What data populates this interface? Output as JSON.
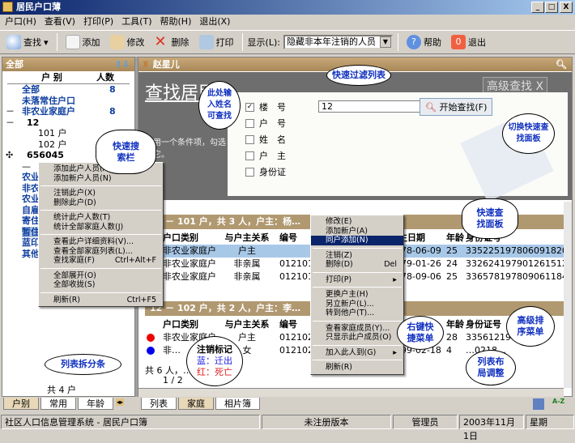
{
  "window": {
    "title": "居民户口薄",
    "min": "_",
    "max": "□",
    "close": "X"
  },
  "menu": [
    "户口(H)",
    "查看(V)",
    "打印(P)",
    "工具(T)",
    "帮助(H)",
    "退出(X)"
  ],
  "toolbar": {
    "find": "查找",
    "add": "添加",
    "edit": "修改",
    "delete": "删除",
    "print": "打印",
    "display_label": "显示(L):",
    "display_value": "隐藏非本年注销的人员",
    "help": "帮助",
    "exit": "退出"
  },
  "left": {
    "header": "全部",
    "col_type": "户 别",
    "col_count": "人数",
    "tree": [
      {
        "label": "全部",
        "count": "8",
        "cls": "blue",
        "pre": ""
      },
      {
        "label": "未落常住户口",
        "count": "",
        "cls": "blue",
        "pre": ""
      },
      {
        "label": "非农业家庭户",
        "count": "8",
        "cls": "blue",
        "pre": "－"
      },
      {
        "label": "12",
        "count": "",
        "cls": "bold",
        "pre": "－"
      },
      {
        "label": "101 户",
        "count": "",
        "cls": "",
        "pre": ""
      },
      {
        "label": "102 户",
        "count": "",
        "cls": "",
        "pre": ""
      },
      {
        "label": "656045",
        "count": "",
        "cls": "bold",
        "pre": "✣"
      },
      {
        "label": "—",
        "count": "",
        "cls": "",
        "pre": ""
      },
      {
        "label": "农业",
        "count": "",
        "cls": "blue",
        "pre": ""
      },
      {
        "label": "非农",
        "count": "",
        "cls": "blue",
        "pre": ""
      },
      {
        "label": "农业",
        "count": "",
        "cls": "blue",
        "pre": ""
      },
      {
        "label": "自雇",
        "count": "",
        "cls": "blue",
        "pre": ""
      },
      {
        "label": "寄住",
        "count": "",
        "cls": "blue",
        "pre": ""
      },
      {
        "label": "暂住",
        "count": "",
        "cls": "blue",
        "pre": ""
      },
      {
        "label": "蓝印",
        "count": "",
        "cls": "blue",
        "pre": ""
      },
      {
        "label": "其他",
        "count": "",
        "cls": "blue",
        "pre": ""
      }
    ],
    "footer": "共 4 户",
    "tabs": [
      "户别",
      "常用",
      "年龄"
    ]
  },
  "right": {
    "header": "赵星儿",
    "search_title": "查找居民",
    "search_hint": "使用一个条件项，勾选中它。",
    "advanced": "高级查找",
    "close": "X",
    "fields": [
      {
        "label": "楼　号",
        "checked": true,
        "value": "12"
      },
      {
        "label": "户　号",
        "checked": false
      },
      {
        "label": "姓　名",
        "checked": false
      },
      {
        "label": "户　主",
        "checked": false
      },
      {
        "label": "身份证",
        "checked": false
      }
    ],
    "start_search": "开始查找(F)",
    "columns": [
      "户口类别",
      "与户主关系",
      "编号",
      "出生日期",
      "年龄",
      "身份证号"
    ],
    "groups": [
      {
        "title": "12 － 101 户，共 3 人，户主：杨…",
        "rows": [
          [
            "非农业家庭户",
            "户主",
            "",
            "1978-06-09",
            "25",
            "335225197806091820"
          ],
          [
            "非农业家庭户",
            "非亲属",
            "0121010…",
            "1979-01-26",
            "24",
            "33262419790126151X"
          ],
          [
            "非农业家庭户",
            "非亲属",
            "0121010…",
            "1978-09-06",
            "25",
            "336578197809061184"
          ]
        ]
      },
      {
        "title": "12 － 102 户，共 2 人，户主：李…",
        "rows": [
          [
            "非农业家庭户",
            "户主",
            "0121020…",
            "",
            "28",
            "335612197…"
          ],
          [
            "非…",
            "女",
            "0121020…",
            "1999-02-18",
            "4",
            "…0218…"
          ]
        ]
      }
    ],
    "summary": "共 6 人，… 女 4 人",
    "page": "1 / 2",
    "tabs": [
      "列表",
      "家庭",
      "相片簿"
    ],
    "sort_label": "A-Z"
  },
  "context_left": [
    {
      "t": "添加此户人员(A)"
    },
    {
      "t": "添加新户人员(N)"
    },
    {
      "sep": 1
    },
    {
      "t": "注销此户(X)"
    },
    {
      "t": "删除此户(D)"
    },
    {
      "sep": 1
    },
    {
      "t": "统计此户人数(T)"
    },
    {
      "t": "统计全部家庭人数(J)"
    },
    {
      "sep": 1
    },
    {
      "t": "查看此户详细资料(V)..."
    },
    {
      "t": "查看全部家庭列表(L)..."
    },
    {
      "t": "查找家庭(F)",
      "k": "Ctrl+Alt+F"
    },
    {
      "sep": 1
    },
    {
      "t": "全部展开(O)"
    },
    {
      "t": "全部收拢(S)"
    },
    {
      "sep": 1
    },
    {
      "t": "刷新(R)",
      "k": "Ctrl+F5"
    }
  ],
  "context_right": [
    {
      "t": "修改(E)"
    },
    {
      "t": "添加新户(A)"
    },
    {
      "t": "同户添加(N)",
      "hl": 1
    },
    {
      "sep": 1
    },
    {
      "t": "注销(Z)"
    },
    {
      "t": "删除(D)",
      "k": "Del"
    },
    {
      "sep": 1
    },
    {
      "t": "打印(P)",
      "k": "▸"
    },
    {
      "sep": 1
    },
    {
      "t": "更换户主(H)"
    },
    {
      "t": "另立新户(L)..."
    },
    {
      "t": "转到他户(T)..."
    },
    {
      "sep": 1
    },
    {
      "t": "查看家庭成员(Y)..."
    },
    {
      "t": "只显示此户成员(O)"
    },
    {
      "sep": 1
    },
    {
      "t": "加入此人到(G)",
      "k": "▸"
    },
    {
      "sep": 1
    },
    {
      "t": "刷新(R)"
    }
  ],
  "callouts": {
    "filter": "快速过滤列表",
    "name": "此处输入姓名可查找",
    "searchbar": "快速搜索栏",
    "toggle": "切换快速查找面板",
    "panel": "快速查找面板",
    "rightmenu": "右键快捷菜单",
    "sortmenu": "高级排序菜单",
    "layout": "列表布局调整",
    "splitter": "列表拆分条",
    "mark_title": "注销标记",
    "mark_blue": "蓝：迁出",
    "mark_red": "红：死亡"
  },
  "status": {
    "app": "社区人口信息管理系统 - 居民户口簿",
    "reg": "未注册版本",
    "user": "管理员",
    "date": "2003年11月1日",
    "weekday": "星期"
  }
}
